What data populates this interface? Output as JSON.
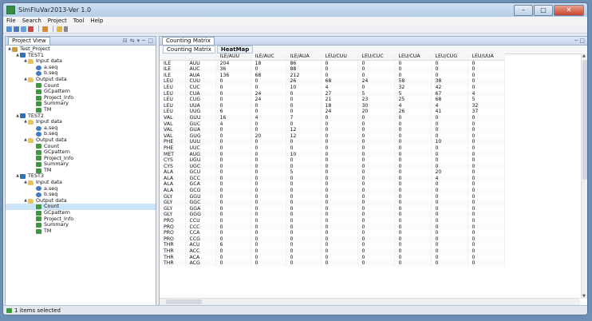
{
  "window": {
    "title": "SimFluVar2013-Ver 1.0"
  },
  "menu": [
    "File",
    "Search",
    "Project",
    "Tool",
    "Help"
  ],
  "project_view": {
    "tab_label": "Project View",
    "nodes": [
      {
        "label": "Test_Project",
        "indent": 0,
        "icon": "proj",
        "tw": "▲"
      },
      {
        "label": "TEST1",
        "indent": 1,
        "icon": "test",
        "tw": "▲"
      },
      {
        "label": "Input data",
        "indent": 2,
        "icon": "fold",
        "tw": "▲"
      },
      {
        "label": "a.seq",
        "indent": 3,
        "icon": "seq",
        "tw": ""
      },
      {
        "label": "b.seq",
        "indent": 3,
        "icon": "seq",
        "tw": ""
      },
      {
        "label": "Output data",
        "indent": 2,
        "icon": "fold",
        "tw": "▲"
      },
      {
        "label": "Count",
        "indent": 3,
        "icon": "green",
        "tw": ""
      },
      {
        "label": "GCpattern",
        "indent": 3,
        "icon": "green",
        "tw": ""
      },
      {
        "label": "Project_Info",
        "indent": 3,
        "icon": "green",
        "tw": ""
      },
      {
        "label": "Summary",
        "indent": 3,
        "icon": "green",
        "tw": ""
      },
      {
        "label": "TM",
        "indent": 3,
        "icon": "green",
        "tw": ""
      },
      {
        "label": "TEST2",
        "indent": 1,
        "icon": "test",
        "tw": "▲"
      },
      {
        "label": "Input data",
        "indent": 2,
        "icon": "fold",
        "tw": "▲"
      },
      {
        "label": "a.seq",
        "indent": 3,
        "icon": "seq",
        "tw": ""
      },
      {
        "label": "b.seq",
        "indent": 3,
        "icon": "seq",
        "tw": ""
      },
      {
        "label": "Output data",
        "indent": 2,
        "icon": "fold",
        "tw": "▲"
      },
      {
        "label": "Count",
        "indent": 3,
        "icon": "green",
        "tw": ""
      },
      {
        "label": "GCpattern",
        "indent": 3,
        "icon": "green",
        "tw": ""
      },
      {
        "label": "Project_Info",
        "indent": 3,
        "icon": "green",
        "tw": ""
      },
      {
        "label": "Summary",
        "indent": 3,
        "icon": "green",
        "tw": ""
      },
      {
        "label": "TM",
        "indent": 3,
        "icon": "green",
        "tw": ""
      },
      {
        "label": "TEST3",
        "indent": 1,
        "icon": "test",
        "tw": "▲"
      },
      {
        "label": "Input data",
        "indent": 2,
        "icon": "fold",
        "tw": "▲"
      },
      {
        "label": "a.seq",
        "indent": 3,
        "icon": "seq",
        "tw": ""
      },
      {
        "label": "b.seq",
        "indent": 3,
        "icon": "seq",
        "tw": ""
      },
      {
        "label": "Output data",
        "indent": 2,
        "icon": "fold",
        "tw": "▲"
      },
      {
        "label": "Count",
        "indent": 3,
        "icon": "green",
        "tw": "",
        "selected": true
      },
      {
        "label": "GCpattern",
        "indent": 3,
        "icon": "green",
        "tw": ""
      },
      {
        "label": "Project_Info",
        "indent": 3,
        "icon": "green",
        "tw": ""
      },
      {
        "label": "Summary",
        "indent": 3,
        "icon": "green",
        "tw": ""
      },
      {
        "label": "TM",
        "indent": 3,
        "icon": "green",
        "tw": ""
      }
    ]
  },
  "editor": {
    "tab_label": "Counting Matrix",
    "subtabs": [
      "Counting Matrix",
      "HeatMap"
    ],
    "columns": [
      "",
      "",
      "ILE/AUU",
      "ILE/AUC",
      "ILE/AUA",
      "LEU/CUU",
      "LEU/CUC",
      "LEU/CUA",
      "LEU/CUG",
      "LEU/UUA"
    ],
    "rows": [
      [
        "ILE",
        "AUU",
        "204",
        "18",
        "86",
        "0",
        "0",
        "0",
        "0",
        "0"
      ],
      [
        "ILE",
        "AUC",
        "36",
        "0",
        "88",
        "0",
        "0",
        "0",
        "0",
        "0"
      ],
      [
        "ILE",
        "AUA",
        "136",
        "68",
        "212",
        "0",
        "0",
        "0",
        "0",
        "0"
      ],
      [
        "LEU",
        "CUU",
        "0",
        "0",
        "26",
        "68",
        "24",
        "58",
        "38",
        "0"
      ],
      [
        "LEU",
        "CUC",
        "0",
        "0",
        "10",
        "4",
        "0",
        "32",
        "42",
        "0"
      ],
      [
        "LEU",
        "CUA",
        "0",
        "24",
        "0",
        "27",
        "5",
        "5",
        "67",
        "4"
      ],
      [
        "LEU",
        "CUG",
        "0",
        "24",
        "0",
        "21",
        "23",
        "25",
        "68",
        "5"
      ],
      [
        "LEU",
        "UUA",
        "0",
        "0",
        "0",
        "18",
        "30",
        "4",
        "4",
        "32"
      ],
      [
        "LEU",
        "UUG",
        "6",
        "0",
        "0",
        "24",
        "20",
        "26",
        "41",
        "37"
      ],
      [
        "VAL",
        "GUU",
        "16",
        "4",
        "7",
        "0",
        "0",
        "0",
        "0",
        "0"
      ],
      [
        "VAL",
        "GUC",
        "4",
        "0",
        "0",
        "0",
        "0",
        "0",
        "0",
        "0"
      ],
      [
        "VAL",
        "GUA",
        "0",
        "0",
        "12",
        "0",
        "0",
        "0",
        "0",
        "0"
      ],
      [
        "VAL",
        "GUG",
        "0",
        "20",
        "12",
        "0",
        "0",
        "0",
        "0",
        "0"
      ],
      [
        "PHE",
        "UUU",
        "0",
        "0",
        "0",
        "0",
        "0",
        "0",
        "10",
        "0"
      ],
      [
        "PHE",
        "UUC",
        "0",
        "0",
        "0",
        "0",
        "0",
        "0",
        "0",
        "0"
      ],
      [
        "MET",
        "AUG",
        "0",
        "0",
        "10",
        "0",
        "0",
        "0",
        "0",
        "0"
      ],
      [
        "CYS",
        "UGU",
        "0",
        "0",
        "0",
        "0",
        "0",
        "0",
        "0",
        "0"
      ],
      [
        "CYS",
        "UGC",
        "0",
        "0",
        "0",
        "0",
        "0",
        "0",
        "0",
        "0"
      ],
      [
        "ALA",
        "GCU",
        "0",
        "0",
        "5",
        "0",
        "0",
        "0",
        "20",
        "0"
      ],
      [
        "ALA",
        "GCC",
        "0",
        "0",
        "0",
        "0",
        "0",
        "0",
        "4",
        "0"
      ],
      [
        "ALA",
        "GCA",
        "0",
        "0",
        "0",
        "0",
        "0",
        "0",
        "0",
        "0"
      ],
      [
        "ALA",
        "GCG",
        "0",
        "0",
        "0",
        "0",
        "0",
        "0",
        "0",
        "0"
      ],
      [
        "GLY",
        "GGU",
        "0",
        "0",
        "0",
        "0",
        "0",
        "0",
        "0",
        "0"
      ],
      [
        "GLY",
        "GGC",
        "0",
        "0",
        "0",
        "0",
        "0",
        "0",
        "0",
        "0"
      ],
      [
        "GLY",
        "GGA",
        "0",
        "0",
        "0",
        "0",
        "0",
        "0",
        "0",
        "0"
      ],
      [
        "GLY",
        "GGG",
        "0",
        "0",
        "0",
        "0",
        "0",
        "0",
        "0",
        "0"
      ],
      [
        "PRO",
        "CCU",
        "0",
        "0",
        "0",
        "0",
        "0",
        "0",
        "0",
        "0"
      ],
      [
        "PRO",
        "CCC",
        "0",
        "0",
        "0",
        "0",
        "0",
        "0",
        "0",
        "0"
      ],
      [
        "PRO",
        "CCA",
        "0",
        "0",
        "0",
        "0",
        "0",
        "0",
        "0",
        "0"
      ],
      [
        "PRO",
        "CCG",
        "0",
        "0",
        "0",
        "0",
        "0",
        "0",
        "0",
        "0"
      ],
      [
        "THR",
        "ACU",
        "6",
        "0",
        "0",
        "0",
        "0",
        "0",
        "0",
        "0"
      ],
      [
        "THR",
        "ACC",
        "0",
        "0",
        "0",
        "0",
        "0",
        "0",
        "0",
        "0"
      ],
      [
        "THR",
        "ACA",
        "0",
        "0",
        "0",
        "0",
        "0",
        "0",
        "0",
        "0"
      ],
      [
        "THR",
        "ACG",
        "0",
        "0",
        "0",
        "0",
        "0",
        "0",
        "0",
        "0"
      ]
    ]
  },
  "status": {
    "text": "1 items selected"
  }
}
